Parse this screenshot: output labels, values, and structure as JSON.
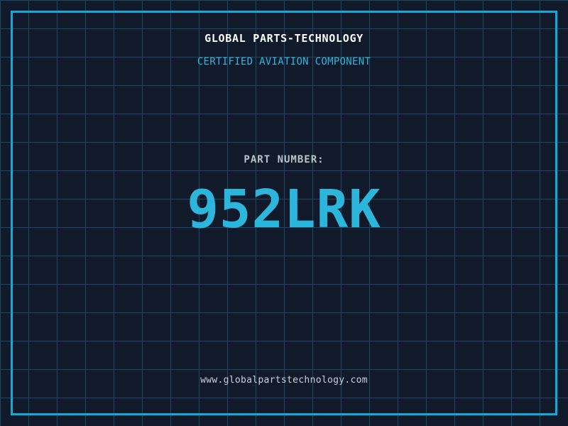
{
  "brand": {
    "title": "GLOBAL PARTS-TECHNOLOGY",
    "subtitle": "CERTIFIED AVIATION COMPONENT"
  },
  "part": {
    "label": "PART NUMBER:",
    "number": "952LRK"
  },
  "footer": {
    "website": "www.globalpartstechnology.com"
  },
  "colors": {
    "background": "#101A2B",
    "grid_line": "#1D4A61",
    "frame": "#0EABD6",
    "title": "#FBFDFE",
    "subtitle": "#2CB6DC",
    "part_label": "#B9C2CB",
    "part_number": "#2CB6DC",
    "website": "#C7D0D8"
  }
}
